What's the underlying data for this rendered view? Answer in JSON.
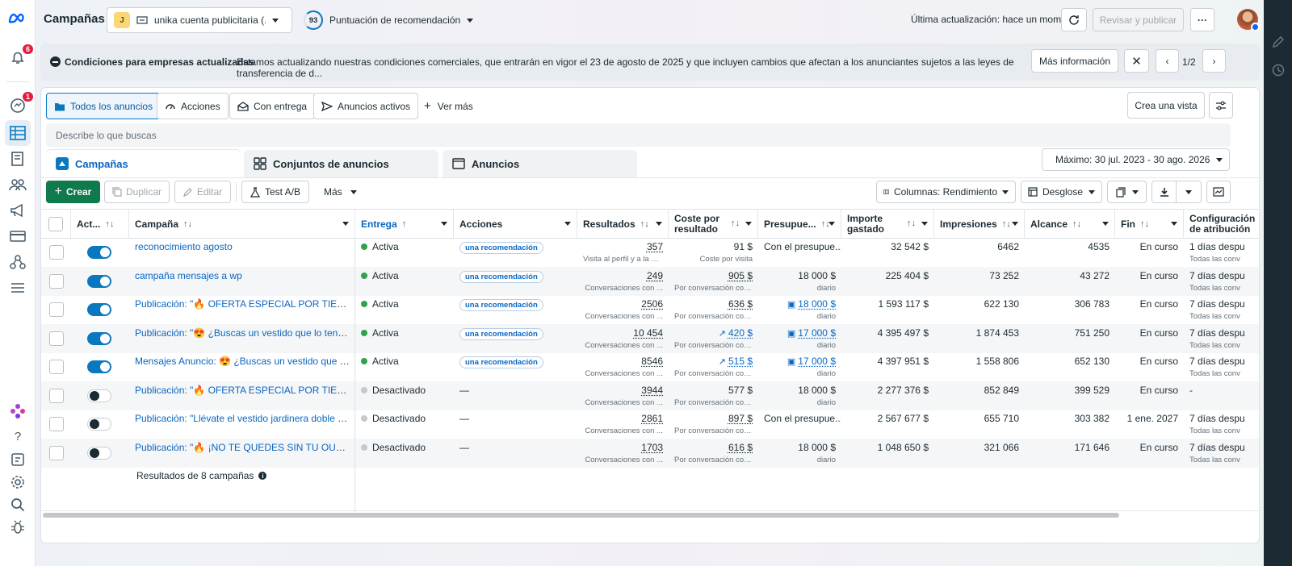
{
  "app": {
    "title": "Campañas",
    "account_initial": "J",
    "account_name": "unika cuenta publicitaria (...",
    "score": "93",
    "score_label": "Puntuación de recomendación",
    "last_update": "Última actualización: hace un momento",
    "review_publish": "Revisar y publicar",
    "more": "···"
  },
  "rail": {
    "notif_badge": "6",
    "msg_badge": "1"
  },
  "banner": {
    "title": "Condiciones para empresas actualizadas",
    "text": "Estamos actualizando nuestras condiciones comerciales, que entrarán en vigor el 23 de agosto de 2025 y que incluyen cambios que afectan a los anunciantes sujetos a las leyes de transferencia de d...",
    "more_info": "Más información",
    "pager": "1/2"
  },
  "views": {
    "all": "Todos los anuncios",
    "actions": "Acciones",
    "delivery": "Con entrega",
    "active": "Anuncios activos",
    "see_more": "Ver más",
    "create_view": "Crea una vista"
  },
  "search": {
    "placeholder": "Describe lo que buscas"
  },
  "levels": {
    "campaigns": "Campañas",
    "adsets": "Conjuntos de anuncios",
    "ads": "Anuncios"
  },
  "date_range": "Máximo: 30 jul. 2023 - 30 ago. 2026",
  "toolbar": {
    "create": "Crear",
    "duplicate": "Duplicar",
    "edit": "Editar",
    "ab_test": "Test A/B",
    "more": "Más",
    "columns": "Columnas: Rendimiento",
    "breakdown": "Desglose"
  },
  "columns": {
    "act": "Act...",
    "campaign": "Campaña",
    "delivery": "Entrega",
    "actions": "Acciones",
    "results": "Resultados",
    "cpr": "Coste por resultado",
    "budget": "Presupue...",
    "spent": "Importe gastado",
    "impressions": "Impresiones",
    "reach": "Alcance",
    "end": "Fin",
    "attribution": "Configuración de atribución"
  },
  "rows": [
    {
      "on": true,
      "name": "reconocimiento agosto",
      "delivery": "Activa",
      "status": "active",
      "actions": "una recomendación",
      "results": "357",
      "results_sub": "Visita al perfil y a la pá...",
      "cpr": "91 $",
      "cpr_under": false,
      "cpr_icon": "",
      "cpr_sub": "Coste por visita",
      "budget": "Con el presupue...",
      "budget_sub": "",
      "budget_icon": "",
      "spent": "32 542 $",
      "impressions": "6462",
      "reach": "4535",
      "end": "En curso",
      "attr": "1 días despu",
      "attr_sub": "Todas las conv"
    },
    {
      "on": true,
      "name": "campaña mensajes a wp",
      "delivery": "Activa",
      "status": "active",
      "actions": "una recomendación",
      "results": "249",
      "results_sub": "Conversaciones con ...",
      "cpr": "905 $",
      "cpr_under": true,
      "cpr_icon": "",
      "cpr_sub": "Por conversación con ...",
      "budget": "18 000 $",
      "budget_sub": "diario",
      "budget_icon": "",
      "spent": "225 404 $",
      "impressions": "73 252",
      "reach": "43 272",
      "end": "En curso",
      "attr": "7 días despu",
      "attr_sub": "Todas las conv"
    },
    {
      "on": true,
      "name": "Publicación: \"🔥 OFERTA ESPECIAL POR TIEMPO ...",
      "delivery": "Activa",
      "status": "active",
      "actions": "una recomendación",
      "results": "2506",
      "results_sub": "Conversaciones con ...",
      "cpr": "636 $",
      "cpr_under": true,
      "cpr_icon": "",
      "cpr_sub": "Por conversación con ...",
      "budget": "18 000 $",
      "budget_sub": "diario",
      "budget_icon": "chart-icon",
      "spent": "1 593 117 $",
      "impressions": "622 130",
      "reach": "306 783",
      "end": "En curso",
      "attr": "7 días despu",
      "attr_sub": "Todas las conv"
    },
    {
      "on": true,
      "name": "Publicación: \"😍 ¿Buscas un vestido que lo tenga TO...",
      "delivery": "Activa",
      "status": "active",
      "actions": "una recomendación",
      "results": "10 454",
      "results_sub": "Conversaciones con ...",
      "cpr": "420 $",
      "cpr_under": true,
      "cpr_icon": "trend-icon",
      "cpr_sub": "Por conversación con ...",
      "budget": "17 000 $",
      "budget_sub": "diario",
      "budget_icon": "chart-icon",
      "spent": "4 395 497 $",
      "impressions": "1 874 453",
      "reach": "751 250",
      "end": "En curso",
      "attr": "7 días despu",
      "attr_sub": "Todas las conv"
    },
    {
      "on": true,
      "name": "Mensajes Anuncio: 😍 ¿Buscas un vestido que lo ten...",
      "delivery": "Activa",
      "status": "active",
      "actions": "una recomendación",
      "results": "8546",
      "results_sub": "Conversaciones con ...",
      "cpr": "515 $",
      "cpr_under": true,
      "cpr_icon": "trend-icon",
      "cpr_sub": "Por conversación con ...",
      "budget": "17 000 $",
      "budget_sub": "diario",
      "budget_icon": "chart-icon",
      "spent": "4 397 951 $",
      "impressions": "1 558 806",
      "reach": "652 130",
      "end": "En curso",
      "attr": "7 días despu",
      "attr_sub": "Todas las conv"
    },
    {
      "on": false,
      "name": "Publicación: \"🔥 OFERTA ESPECIAL POR TIEMPO ...",
      "delivery": "Desactivado",
      "status": "off",
      "actions": "—",
      "results": "3944",
      "results_sub": "Conversaciones con ...",
      "cpr": "577 $",
      "cpr_under": false,
      "cpr_icon": "",
      "cpr_sub": "Por conversación con ...",
      "budget": "18 000 $",
      "budget_sub": "diario",
      "budget_icon": "",
      "spent": "2 277 376 $",
      "impressions": "852 849",
      "reach": "399 529",
      "end": "En curso",
      "attr": "-",
      "attr_sub": ""
    },
    {
      "on": false,
      "name": "Publicación: \"Llévate el vestido jardinera doble tela (...",
      "delivery": "Desactivado",
      "status": "off",
      "actions": "—",
      "results": "2861",
      "results_sub": "Conversaciones con ...",
      "cpr": "897 $",
      "cpr_under": true,
      "cpr_icon": "",
      "cpr_sub": "Por conversación con ...",
      "budget": "Con el presupue...",
      "budget_sub": "",
      "budget_icon": "",
      "spent": "2 567 677 $",
      "impressions": "655 710",
      "reach": "303 382",
      "end": "1 ene. 2027",
      "attr": "7 días despu",
      "attr_sub": "Todas las conv"
    },
    {
      "on": false,
      "name": "Publicación: \"🔥 ¡NO TE QUEDES SIN TU OUTFIT ID...",
      "delivery": "Desactivado",
      "status": "off",
      "actions": "—",
      "results": "1703",
      "results_sub": "Conversaciones con ...",
      "cpr": "616 $",
      "cpr_under": true,
      "cpr_icon": "",
      "cpr_sub": "Por conversación con ...",
      "budget": "18 000 $",
      "budget_sub": "diario",
      "budget_icon": "",
      "spent": "1 048 650 $",
      "impressions": "321 066",
      "reach": "171 646",
      "end": "En curso",
      "attr": "7 días despu",
      "attr_sub": "Todas las conv"
    }
  ],
  "footer": {
    "summary": "Resultados de 8 campañas"
  },
  "colors": {
    "accent": "#0a78be",
    "link": "#0a66c2",
    "active": "#31a24c",
    "inactive": "#c6c9cd"
  }
}
